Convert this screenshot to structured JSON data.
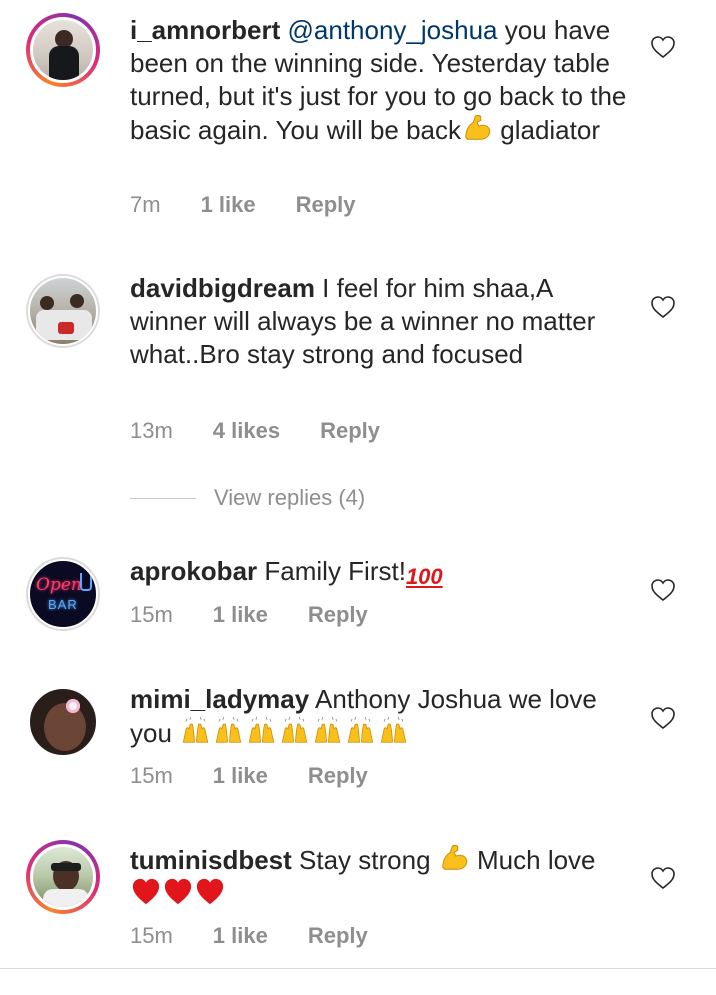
{
  "comments": [
    {
      "username": "i_amnorbert",
      "mention": "@anthony_joshua",
      "text1": "you have been on the winning side. Yesterday table turned, but it's just for you to go back to the basic again. You will be back",
      "emoji1": "flexed-biceps",
      "text2": "gladiator",
      "time": "7m",
      "likes": "1 like",
      "reply": "Reply",
      "avatar_ring": true
    },
    {
      "username": "davidbigdream",
      "text1": "I feel for him shaa,A winner will always be a winner no matter what..Bro stay strong and focused",
      "time": "13m",
      "likes": "4 likes",
      "reply": "Reply",
      "avatar_ring": false
    },
    {
      "username": "aprokobar",
      "text1": "Family First!",
      "emoji1": "hundred-points",
      "time": "15m",
      "likes": "1 like",
      "reply": "Reply",
      "avatar_text1": "Open",
      "avatar_text2": "BAR",
      "avatar_ring": false
    },
    {
      "username": "mimi_ladymay",
      "text1": "Anthony Joshua we love you",
      "emoji1": "raising-hands x7",
      "time": "15m",
      "likes": "1 like",
      "reply": "Reply",
      "avatar_ring": false
    },
    {
      "username": "tuminisdbest",
      "text1": "Stay strong",
      "emoji1": "flexed-biceps",
      "text2": "Much love",
      "emoji2": "red-heart x3",
      "time": "15m",
      "likes": "1 like",
      "reply": "Reply",
      "avatar_ring": true
    }
  ],
  "view_replies": "View replies (4)",
  "colors": {
    "accent": "#00376b",
    "meta": "#8e8e8e",
    "heart_emoji": "#e0161b",
    "flex_emoji": "#f9c01c"
  }
}
